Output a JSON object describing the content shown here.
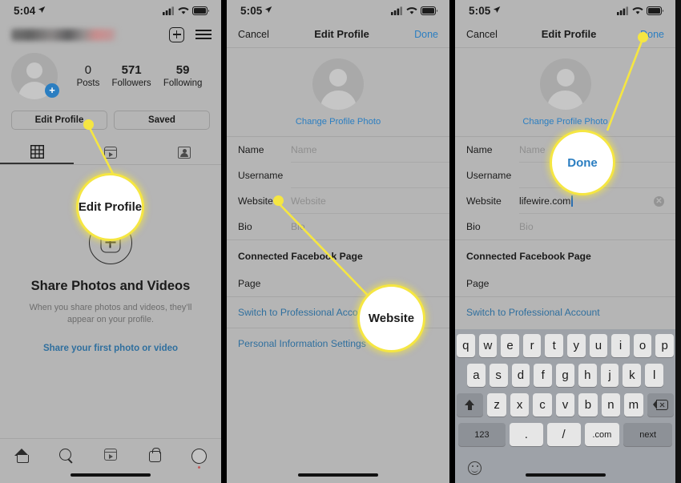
{
  "panels": [
    {
      "status": {
        "time": "5:04",
        "location_icon": "location-arrow-icon",
        "cellular_icon": "cellular-bars-icon",
        "wifi_icon": "wifi-icon",
        "battery_icon": "battery-icon"
      },
      "header": {
        "username_redacted": "",
        "add_icon": "plus-box-icon",
        "menu_icon": "hamburger-menu-icon"
      },
      "stats": [
        {
          "num": "0",
          "label": "Posts"
        },
        {
          "num": "571",
          "label": "Followers"
        },
        {
          "num": "59",
          "label": "Following"
        }
      ],
      "buttons": {
        "edit_profile": "Edit Profile",
        "saved": "Saved"
      },
      "tabs": [
        {
          "name": "grid-tab",
          "icon": "grid-icon",
          "active": true
        },
        {
          "name": "reels-tab",
          "icon": "reels-icon",
          "active": false
        },
        {
          "name": "tagged-tab",
          "icon": "tagged-icon",
          "active": false
        }
      ],
      "empty_state": {
        "title": "Share Photos and Videos",
        "subtitle": "When you share photos and videos, they’ll appear on your profile.",
        "link": "Share your first photo or video"
      },
      "tabbar": [
        "home-icon",
        "search-icon",
        "reels-icon",
        "shop-icon",
        "profile-avatar-icon"
      ]
    },
    {
      "status": {
        "time": "5:05"
      },
      "nav": {
        "cancel": "Cancel",
        "title": "Edit Profile",
        "done": "Done"
      },
      "photo": {
        "change_label": "Change Profile Photo"
      },
      "fields": [
        {
          "label": "Name",
          "value": "",
          "placeholder": "Name"
        },
        {
          "label": "Username",
          "value": "",
          "placeholder": ""
        },
        {
          "label": "Website",
          "value": "",
          "placeholder": "Website"
        },
        {
          "label": "Bio",
          "value": "",
          "placeholder": "Bio"
        }
      ],
      "section": {
        "heading": "Connected Facebook Page",
        "page_label": "Page",
        "page_value": ""
      },
      "links": [
        "Switch to Professional Account",
        "Personal Information Settings"
      ]
    },
    {
      "status": {
        "time": "5:05"
      },
      "nav": {
        "cancel": "Cancel",
        "title": "Edit Profile",
        "done": "Done"
      },
      "photo": {
        "change_label": "Change Profile Photo"
      },
      "fields": [
        {
          "label": "Name",
          "value": "",
          "placeholder": "Name"
        },
        {
          "label": "Username",
          "value": "",
          "placeholder": ""
        },
        {
          "label": "Website",
          "value": "lifewire.com",
          "placeholder": "Website"
        },
        {
          "label": "Bio",
          "value": "",
          "placeholder": "Bio"
        }
      ],
      "section": {
        "heading": "Connected Facebook Page",
        "page_label": "Page",
        "page_value": ""
      },
      "links": [
        "Switch to Professional Account"
      ],
      "keyboard": {
        "row1": [
          "q",
          "w",
          "e",
          "r",
          "t",
          "y",
          "u",
          "i",
          "o",
          "p"
        ],
        "row2": [
          "a",
          "s",
          "d",
          "f",
          "g",
          "h",
          "j",
          "k",
          "l"
        ],
        "row3": [
          "z",
          "x",
          "c",
          "v",
          "b",
          "n",
          "m"
        ],
        "shift_icon": "shift-icon",
        "delete_icon": "delete-backspace-icon",
        "numbers_key": "123",
        "dot_key": ".",
        "slash_key": "/",
        "dotcom_key": ".com",
        "next_key": "next",
        "emoji_icon": "emoji-smiley-icon"
      }
    }
  ],
  "callouts": [
    {
      "text": "Edit Profile",
      "style": "dark"
    },
    {
      "text": "Website",
      "style": "dark"
    },
    {
      "text": "Done",
      "style": "blue"
    }
  ],
  "colors": {
    "accent_blue": "#2b7ec1",
    "link_blue": "#2f6f9e",
    "callout_yellow": "#f5e642",
    "screen_bg": "#b5b5b5"
  }
}
